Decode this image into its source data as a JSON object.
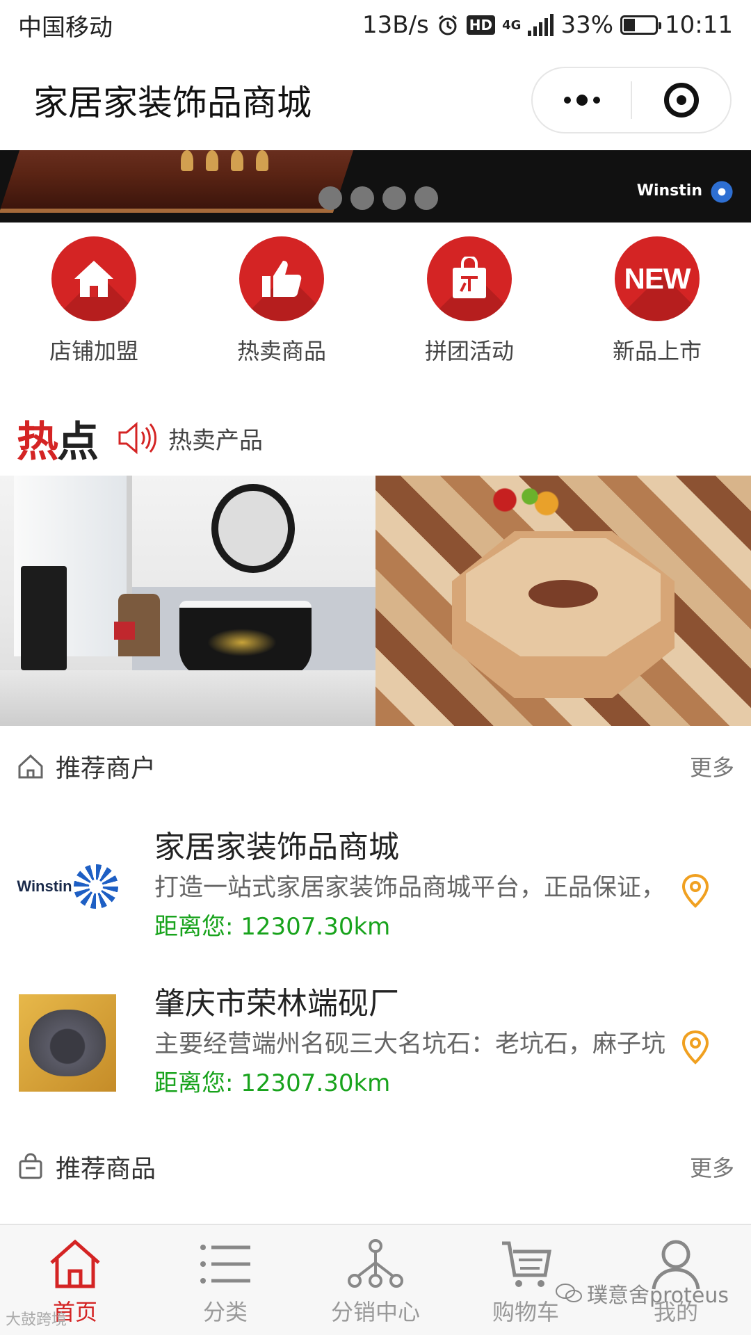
{
  "status_bar": {
    "carrier": "中国移动",
    "net_speed": "13B/s",
    "hd": "HD",
    "network": "4G",
    "battery": "33%",
    "time": "10:11"
  },
  "title_bar": {
    "title": "家居家装饰品商城",
    "menu_icon": "more-dots-icon",
    "close_icon": "target-icon"
  },
  "banner": {
    "brand": "Winstin",
    "page_count": 4,
    "colors": {
      "background": "#111111"
    }
  },
  "quick_nav": [
    {
      "label": "店铺加盟",
      "icon": "home-icon"
    },
    {
      "label": "热卖商品",
      "icon": "thumbs-up-icon"
    },
    {
      "label": "拼团活动",
      "icon": "shopping-bag-icon"
    },
    {
      "label": "新品上市",
      "icon": "new-badge-icon",
      "badge": "NEW"
    }
  ],
  "hot": {
    "logo_part1": "热",
    "logo_part2": "点",
    "text": "热卖产品"
  },
  "recommended_merchants": {
    "title": "推荐商户",
    "more": "更多",
    "items": [
      {
        "name": "家居家装饰品商城",
        "logo_text": "Winstin",
        "description": "打造一站式家居家装饰品商城平台，正品保证，",
        "distance": "距离您: 12307.30km"
      },
      {
        "name": "肇庆市荣林端砚厂",
        "description": "主要经营端州名砚三大名坑石：老坑石，麻子坑",
        "distance": "距离您: 12307.30km"
      }
    ]
  },
  "recommended_products": {
    "title": "推荐商品",
    "more": "更多"
  },
  "tabbar": [
    {
      "label": "首页",
      "icon": "home-icon",
      "active": true
    },
    {
      "label": "分类",
      "icon": "list-icon",
      "active": false
    },
    {
      "label": "分销中心",
      "icon": "network-icon",
      "active": false
    },
    {
      "label": "购物车",
      "icon": "cart-icon",
      "active": false
    },
    {
      "label": "我的",
      "icon": "user-icon",
      "active": false
    }
  ],
  "watermarks": {
    "right": "璞意舍proteus",
    "left": "大鼓跨境"
  },
  "colors": {
    "accent": "#d42424",
    "distance": "#18a31c",
    "pin": "#f0a020"
  }
}
